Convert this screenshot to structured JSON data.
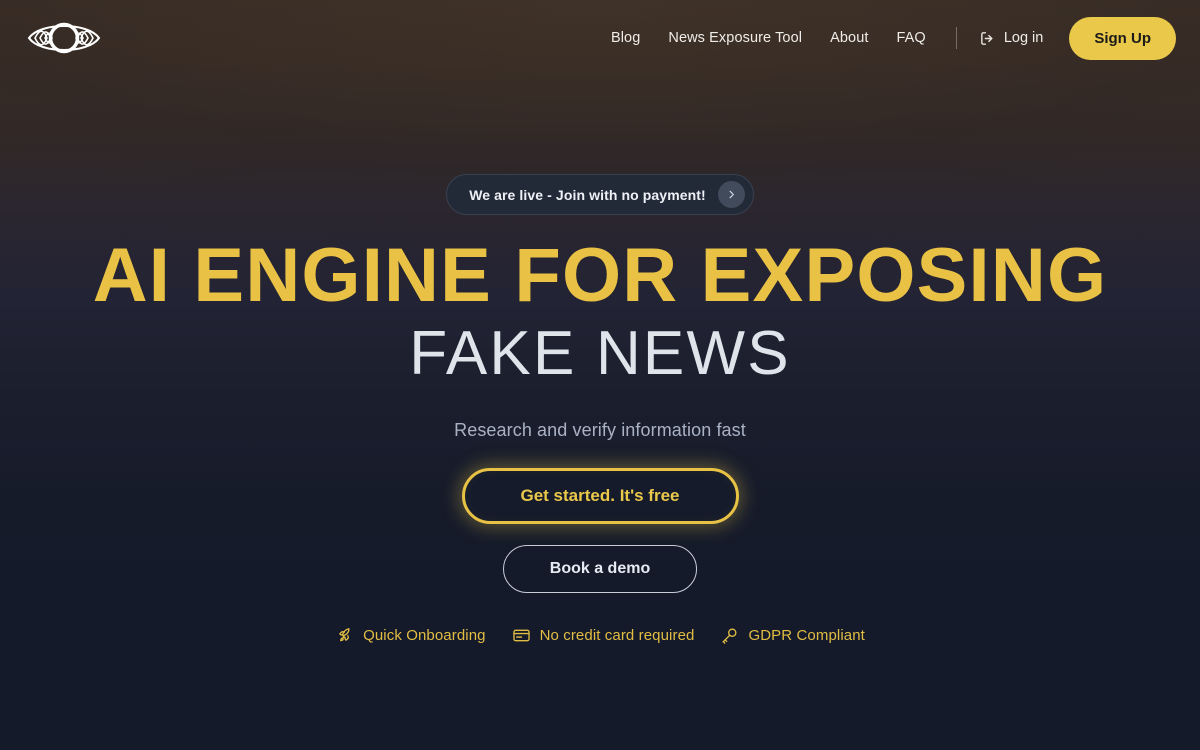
{
  "header": {
    "logo_name": "eye-logo",
    "nav": [
      {
        "label": "Blog",
        "name": "nav-link-blog"
      },
      {
        "label": "News Exposure Tool",
        "name": "nav-link-news-exposure-tool"
      },
      {
        "label": "About",
        "name": "nav-link-about"
      },
      {
        "label": "FAQ",
        "name": "nav-link-faq"
      }
    ],
    "login_label": "Log in",
    "signup_label": "Sign Up"
  },
  "hero": {
    "announcement": {
      "text": "We are live - Join with no payment!",
      "arrow_icon": "chevron-right-icon"
    },
    "headline_line1": "AI ENGINE FOR EXPOSING",
    "headline_line2": "FAKE NEWS",
    "subtitle": "Research and verify information fast",
    "cta_primary": "Get started. It's free",
    "cta_secondary": "Book a demo",
    "features": [
      {
        "label": "Quick Onboarding",
        "icon": "rocket-icon"
      },
      {
        "label": "No credit card required",
        "icon": "credit-card-icon"
      },
      {
        "label": "GDPR Compliant",
        "icon": "key-icon"
      }
    ]
  },
  "colors": {
    "accent_gold": "#e9c245",
    "header_bg": "#3a2e26",
    "page_bg": "#141a29",
    "subtitle": "#a9b2c4"
  }
}
